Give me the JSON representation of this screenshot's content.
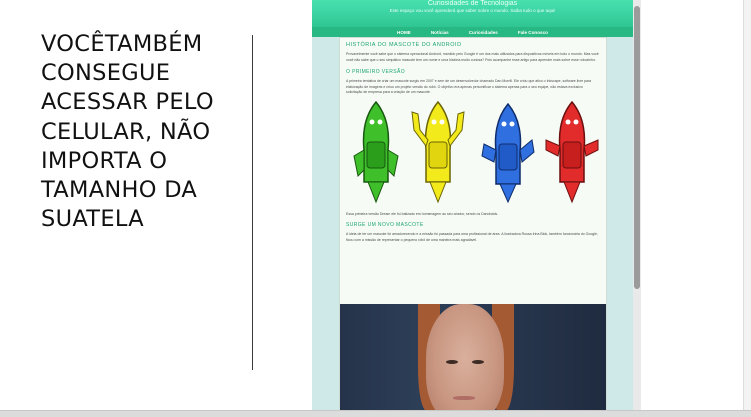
{
  "slide": {
    "lines": [
      "VOCÊTAMBÉM",
      "CONSEGUE",
      "ACESSAR PELO",
      "CELULAR, NÃO",
      "IMPORTA O",
      "TAMANHO DA",
      "SUATELA"
    ]
  },
  "site": {
    "title": "Curiosidades de Tecnologias",
    "subtitle": "Este espaço vou você aprenderá que saber sobre o mundo. Saiba tudo o que aqui!",
    "nav": [
      "HOME",
      "Notícias",
      "Curiosidades",
      "Fale Conosco"
    ],
    "colors": {
      "header": "#3bd6a3",
      "nav": "#27b883",
      "accent": "#1aa56f"
    }
  },
  "article": {
    "title": "HISTÓRIA DO MASCOTE DO ANDROID",
    "intro": "Provavelmente você sabe que o sistema operacional Android, mantido pelo Google é um dos mais utilizados para dispositivos móveis em todo o mundo. Mas você você não sabe que o seu simpático mascote tem um nome e uma história muito curiosa? Pois acompanhe esse artigo para aprender mais sobre esse robozinho.",
    "section1": "O PRIMEIRO VERSÃO",
    "para1": "A primeira tentativa de criar um mascote surgiu em 2007 e sem de um desenvolvedor chamado Dan Morrill. Ele criou que ativo o Inkscape, software livre para elaboração de imagens e criou um projeto versão do robô. O objetivo era apenas personificar o sistema apenas para o seu equipe, não estava exclusivo solicitação de empresa para a criação de um mascote.",
    "caption": "Essa primeira versão Dream ele foi batizado em homenagem ao seu criador, sendo os Dandroids.",
    "section2": "SURGE UM NOVO MASCOTE",
    "para2": "A ideia de ter um mascote foi amadurecendo e a missão foi passada para uma profissional de área. A ilustradora Russa Irina Blok, também funcionária do Google, ficou com a missão de representar o pequeno robô de uma maneira mais agradável."
  },
  "icons": [
    "robot-green-icon",
    "robot-yellow-icon",
    "robot-blue-icon",
    "robot-red-icon",
    "woman-photo"
  ]
}
